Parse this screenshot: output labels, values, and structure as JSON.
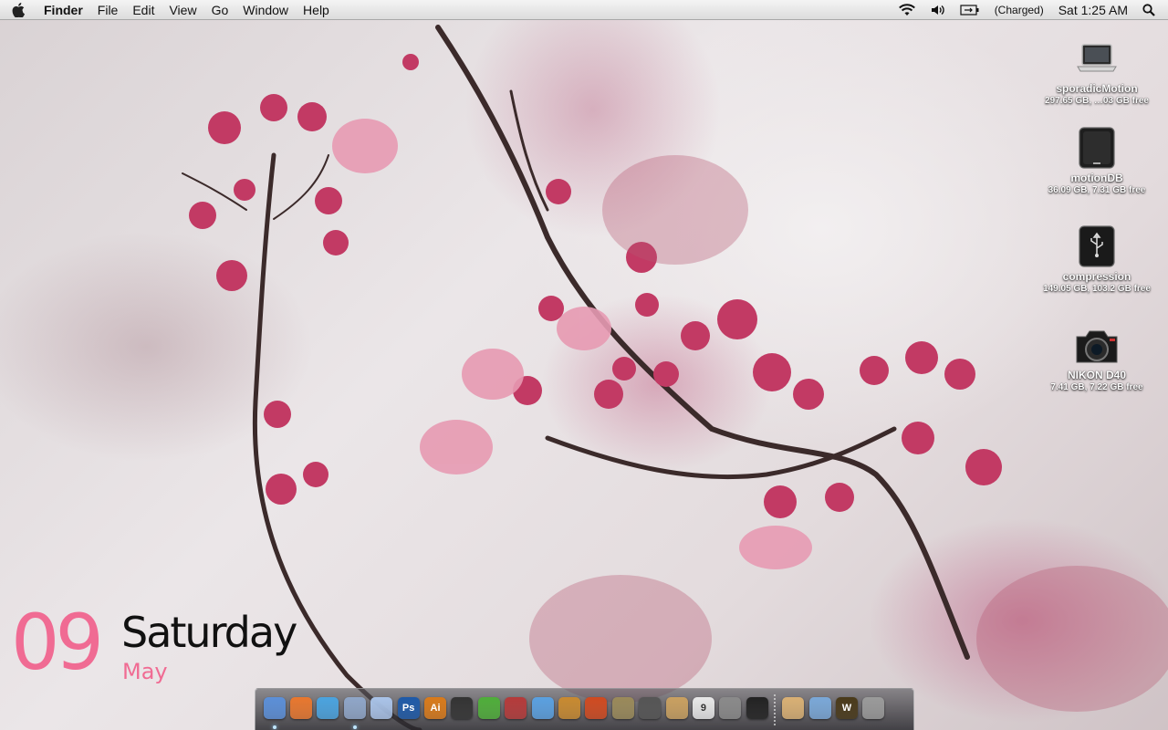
{
  "menubar": {
    "app_name": "Finder",
    "menus": [
      "File",
      "Edit",
      "View",
      "Go",
      "Window",
      "Help"
    ],
    "battery_status": "(Charged)",
    "clock": "Sat 1:25 AM"
  },
  "desktop_icons": [
    {
      "name": "sporadicMotion",
      "info": "297.65 GB, …03 GB free",
      "icon": "laptop-icon"
    },
    {
      "name": "motionDB",
      "info": "36.09 GB, 7.31 GB free",
      "icon": "external-drive-icon"
    },
    {
      "name": "compression",
      "info": "149.05 GB, 103.2 GB free",
      "icon": "usb-drive-icon"
    },
    {
      "name": "NIKON D40",
      "info": "7.41 GB, 7.22 GB free",
      "icon": "camera-icon"
    }
  ],
  "date_widget": {
    "day": "09",
    "weekday": "Saturday",
    "month": "May",
    "accent_color": "#f06b93"
  },
  "dock": {
    "apps": [
      {
        "name": "finder",
        "label": "",
        "color": "#5b8fd8",
        "running": true
      },
      {
        "name": "firefox",
        "label": "",
        "color": "#e8772e",
        "running": false
      },
      {
        "name": "safari",
        "label": "",
        "color": "#4aa3df",
        "running": false
      },
      {
        "name": "mail",
        "label": "",
        "color": "#8fa6c8",
        "running": true
      },
      {
        "name": "ichat",
        "label": "",
        "color": "#a9c3e8",
        "running": false
      },
      {
        "name": "photoshop",
        "label": "Ps",
        "color": "#1e5aa8",
        "running": false
      },
      {
        "name": "illustrator",
        "label": "Ai",
        "color": "#d97a1a",
        "running": false
      },
      {
        "name": "aperture",
        "label": "",
        "color": "#333333",
        "running": false
      },
      {
        "name": "leaf",
        "label": "",
        "color": "#4fae3a",
        "running": false
      },
      {
        "name": "app-red",
        "label": "",
        "color": "#b53a3a",
        "running": false
      },
      {
        "name": "itunes",
        "label": "",
        "color": "#5aa0e0",
        "running": false
      },
      {
        "name": "garageband",
        "label": "",
        "color": "#c88a30",
        "running": false
      },
      {
        "name": "propellerhead",
        "label": "",
        "color": "#d04a20",
        "running": false
      },
      {
        "name": "imovie-star",
        "label": "",
        "color": "#9a8a5a",
        "running": false
      },
      {
        "name": "quicktime",
        "label": "",
        "color": "#555555",
        "running": false
      },
      {
        "name": "address-book",
        "label": "",
        "color": "#c9a060",
        "running": false
      },
      {
        "name": "ical",
        "label": "9",
        "color": "#e8e8e8",
        "running": false
      },
      {
        "name": "system-preferences",
        "label": "",
        "color": "#8a8a8a",
        "running": false
      },
      {
        "name": "terminal",
        "label": "",
        "color": "#222222",
        "running": false
      }
    ],
    "stacks": [
      {
        "name": "stack-documents",
        "label": "",
        "color": "#d9b074"
      },
      {
        "name": "stack-folder",
        "label": "",
        "color": "#7aa8d8"
      },
      {
        "name": "world-of-warcraft",
        "label": "W",
        "color": "#4a3a1a"
      },
      {
        "name": "trash",
        "label": "",
        "color": "#9a9a9a"
      }
    ]
  }
}
